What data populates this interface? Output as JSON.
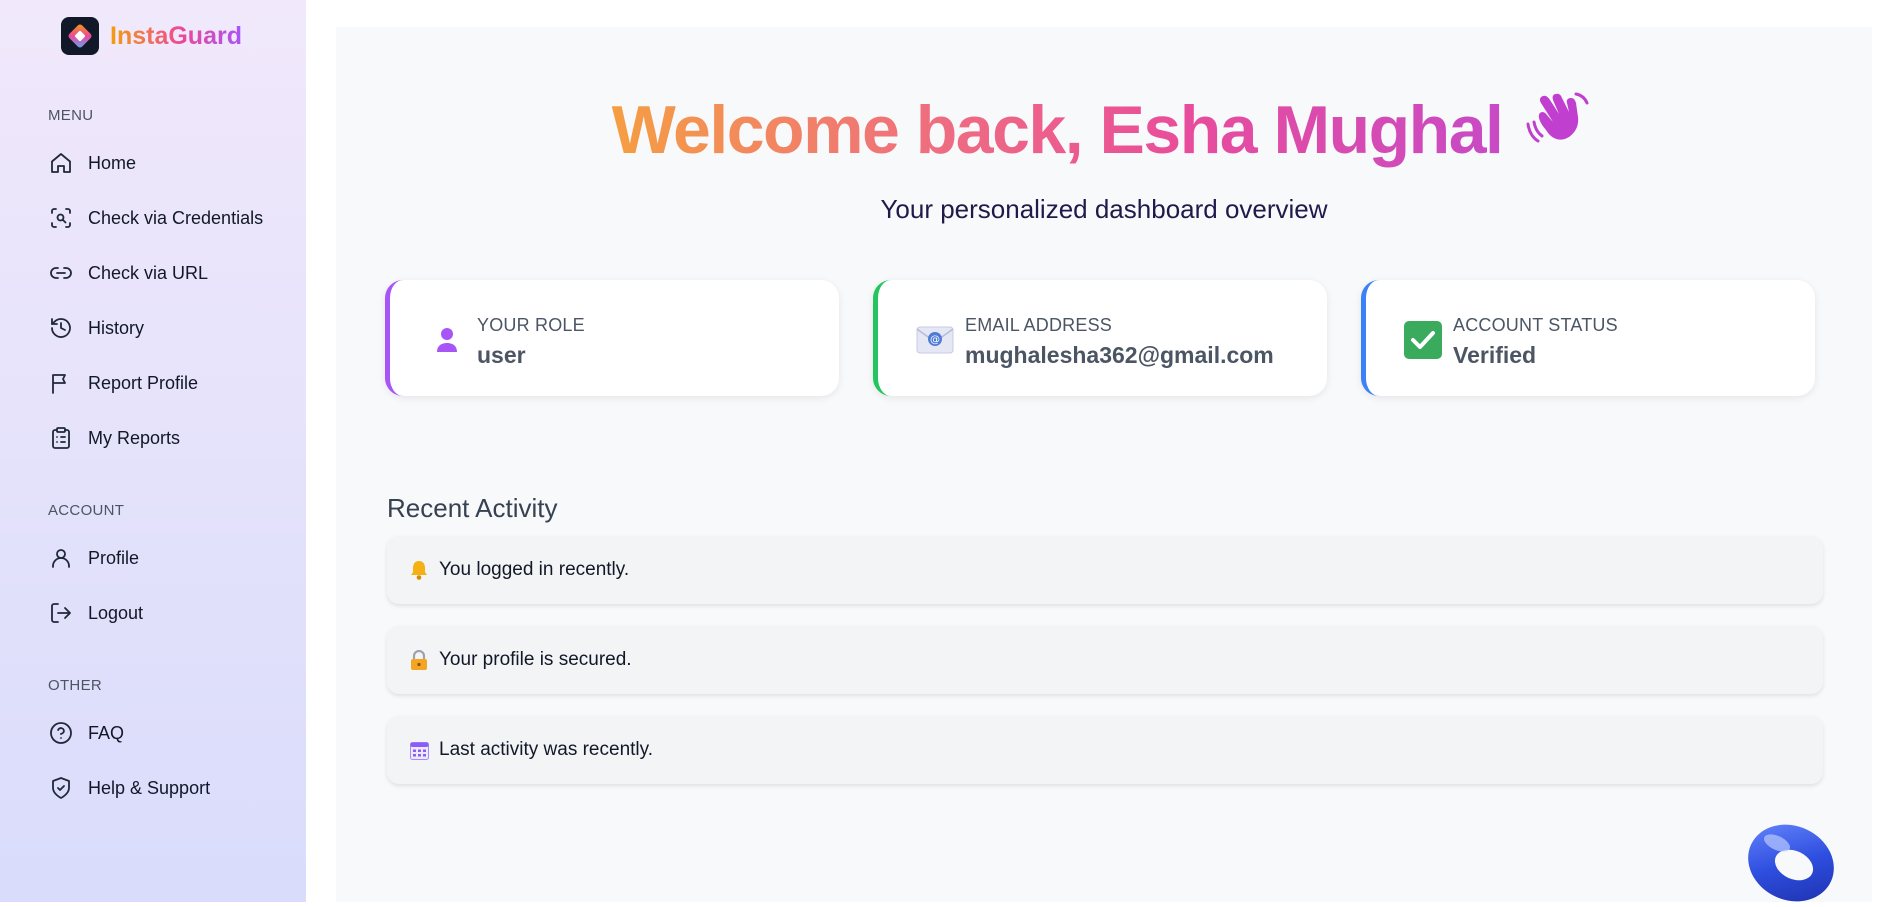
{
  "brand": {
    "name": "InstaGuard"
  },
  "sidebar": {
    "sections": [
      {
        "title": "MENU"
      },
      {
        "title": "ACCOUNT"
      },
      {
        "title": "OTHER"
      }
    ],
    "menu": [
      {
        "label": "Home",
        "icon": "home-icon"
      },
      {
        "label": "Check via Credentials",
        "icon": "scan-search-icon"
      },
      {
        "label": "Check via URL",
        "icon": "link-icon"
      },
      {
        "label": "History",
        "icon": "history-icon"
      },
      {
        "label": "Report Profile",
        "icon": "flag-icon"
      },
      {
        "label": "My Reports",
        "icon": "clipboard-list-icon"
      }
    ],
    "account": [
      {
        "label": "Profile",
        "icon": "user-icon"
      },
      {
        "label": "Logout",
        "icon": "logout-icon"
      }
    ],
    "other": [
      {
        "label": "FAQ",
        "icon": "help-circle-icon"
      },
      {
        "label": "Help & Support",
        "icon": "shield-check-icon"
      }
    ]
  },
  "main": {
    "welcome": "Welcome back, Esha Mughal",
    "subtitle": "Your personalized dashboard overview",
    "cards": [
      {
        "label": "YOUR ROLE",
        "value": "user",
        "icon": "user-icon",
        "accent": "#a855f7"
      },
      {
        "label": "EMAIL ADDRESS",
        "value": "mughalesha362@gmail.com",
        "icon": "email-icon",
        "accent": "#22c55e"
      },
      {
        "label": "ACCOUNT STATUS",
        "value": "Verified",
        "icon": "check-icon",
        "accent": "#3b82f6"
      }
    ],
    "recent_title": "Recent Activity",
    "activities": [
      {
        "text": "You logged in recently.",
        "icon": "bell-icon"
      },
      {
        "text": "Your profile is secured.",
        "icon": "lock-icon"
      },
      {
        "text": "Last activity was recently.",
        "icon": "calendar-icon"
      }
    ]
  },
  "colors": {
    "accent_purple": "#a855f7",
    "accent_green": "#22c55e",
    "accent_blue": "#3b82f6"
  }
}
